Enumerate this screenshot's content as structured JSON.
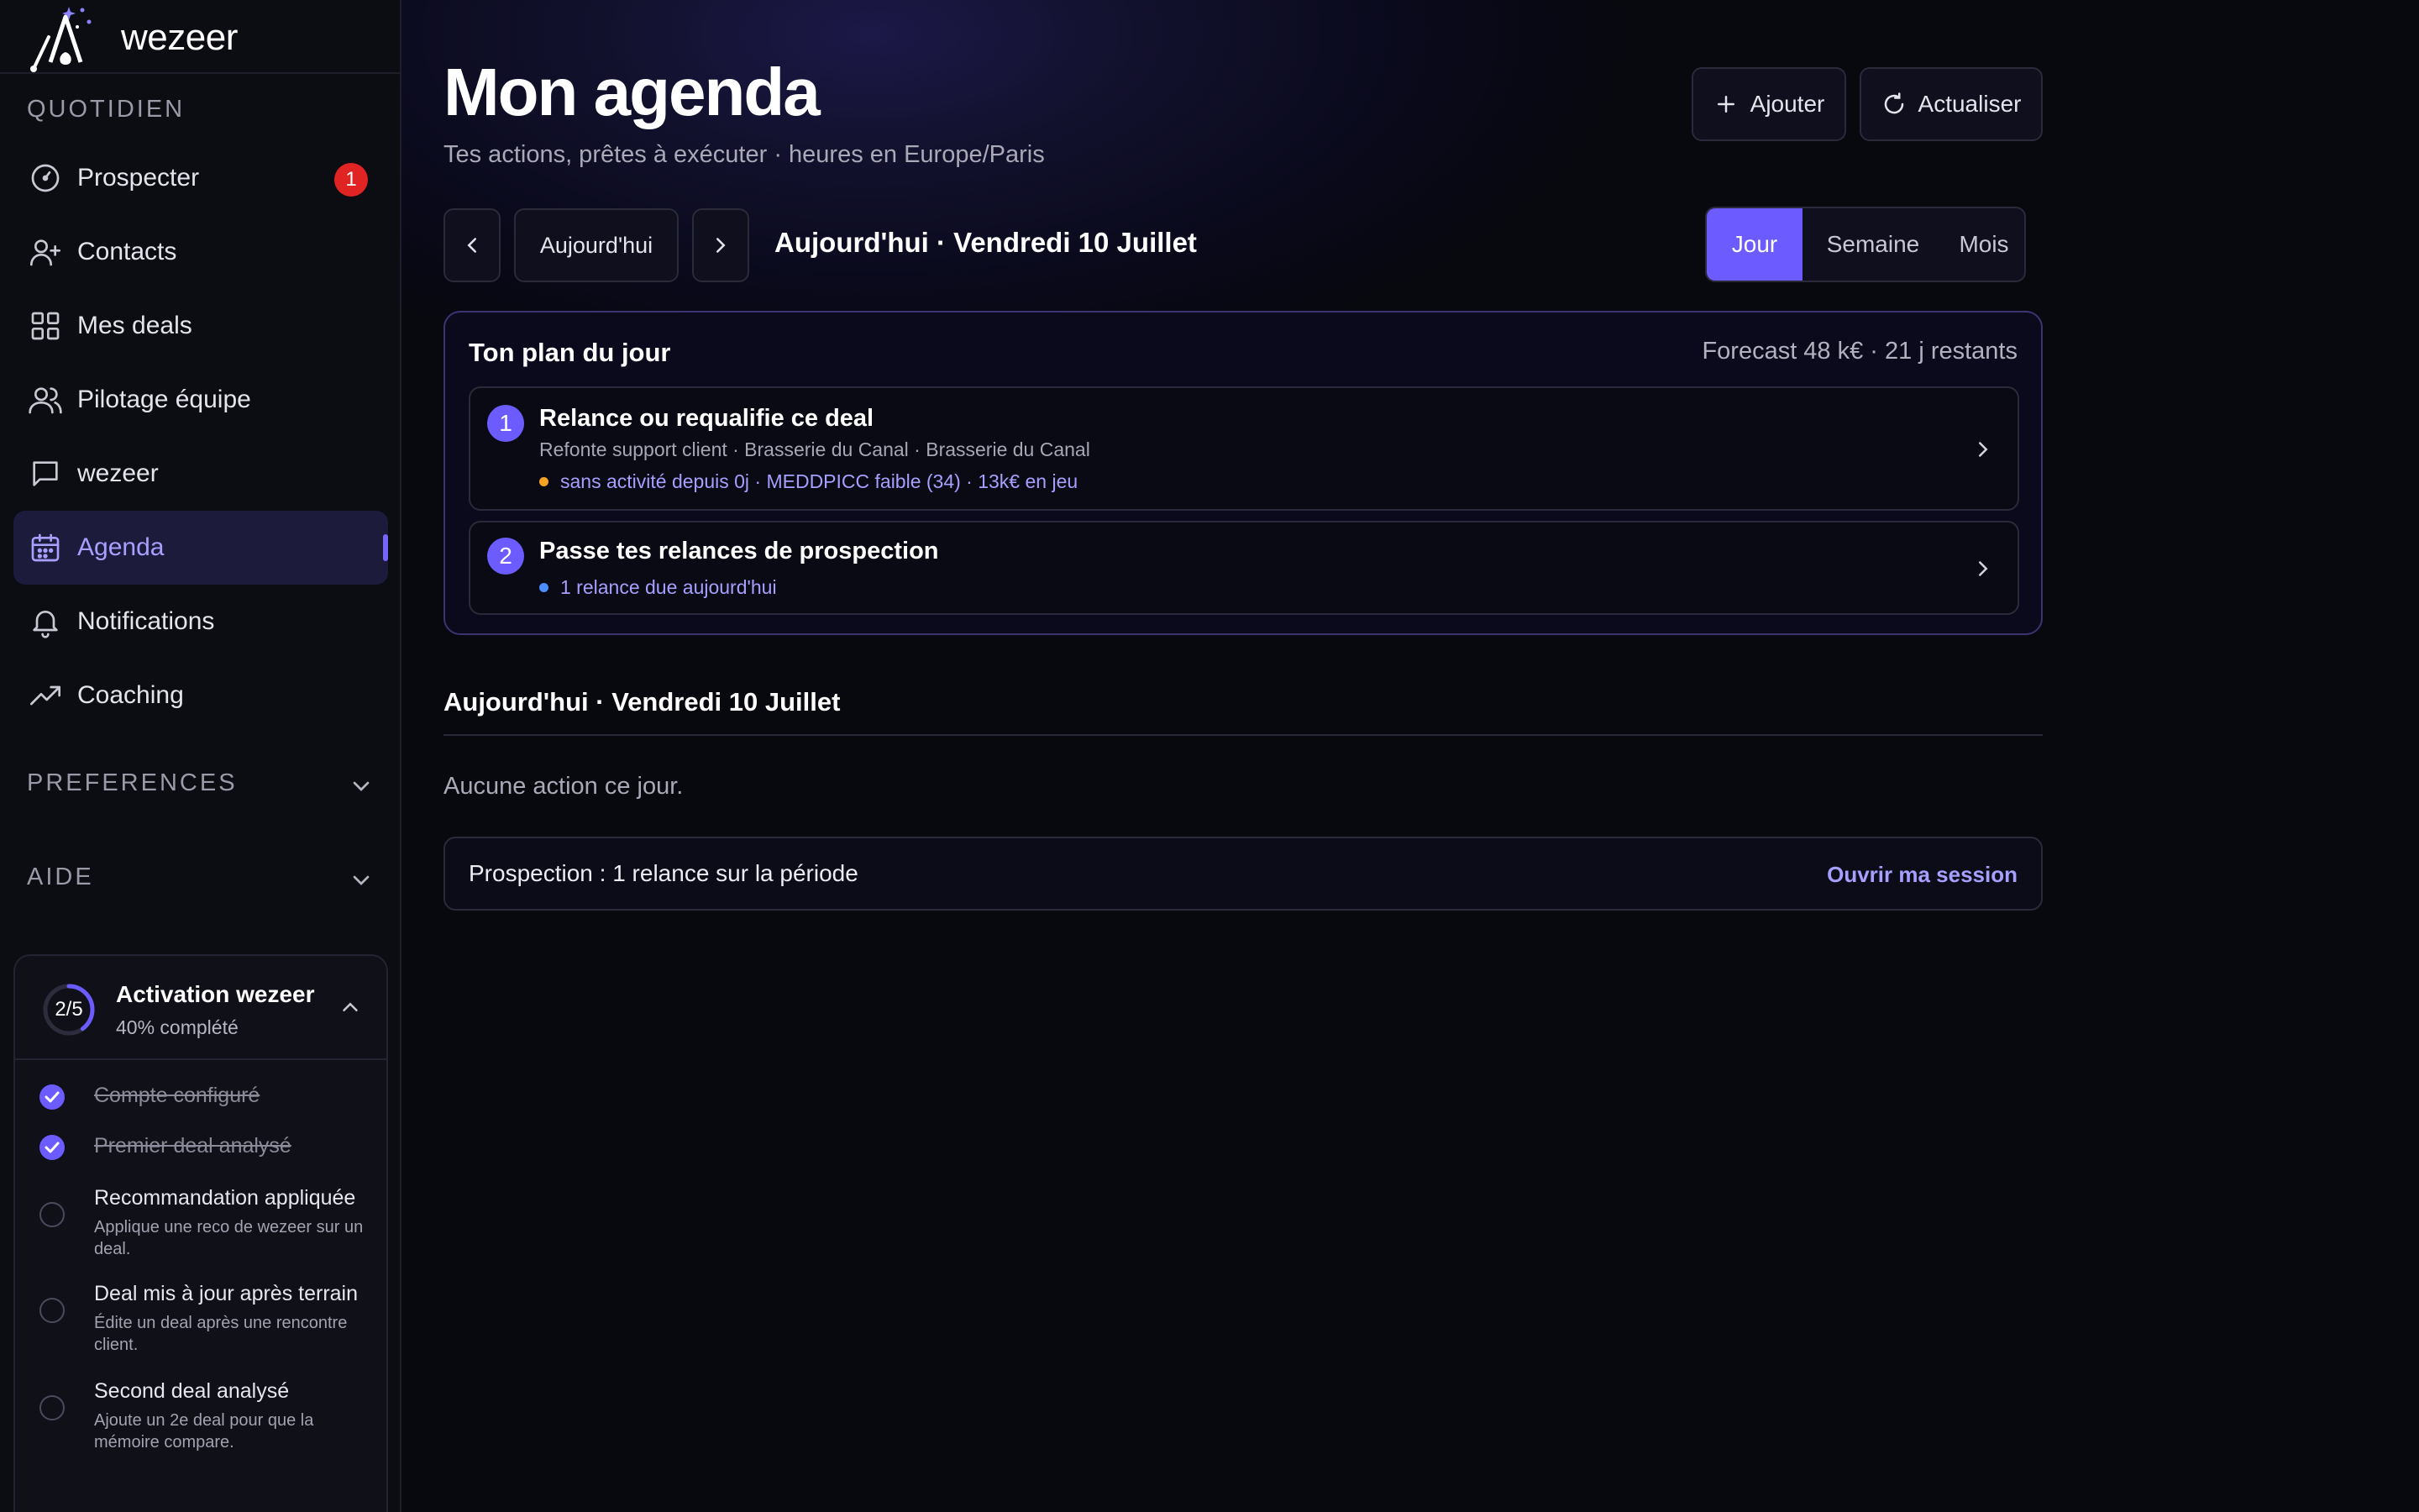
{
  "brand": {
    "name": "wezeer"
  },
  "sidebar": {
    "section_daily": "QUOTIDIEN",
    "items": [
      {
        "label": "Prospecter",
        "icon": "gauge-icon",
        "badge": "1"
      },
      {
        "label": "Contacts",
        "icon": "user-plus-icon"
      },
      {
        "label": "Mes deals",
        "icon": "grid-icon"
      },
      {
        "label": "Pilotage équipe",
        "icon": "users-icon"
      },
      {
        "label": "wezeer",
        "icon": "chat-icon"
      },
      {
        "label": "Agenda",
        "icon": "calendar-icon",
        "active": true
      },
      {
        "label": "Notifications",
        "icon": "bell-icon"
      },
      {
        "label": "Coaching",
        "icon": "trending-up-icon"
      }
    ],
    "section_preferences": "PREFERENCES",
    "section_help": "AIDE"
  },
  "activation": {
    "progress": "2/5",
    "progress_fraction": 0.4,
    "title": "Activation wezeer",
    "subtitle": "40% complété",
    "tasks": [
      {
        "title": "Compte configuré",
        "done": true
      },
      {
        "title": "Premier deal analysé",
        "done": true
      },
      {
        "title": "Recommandation appliquée",
        "desc": "Applique une reco de wezeer sur un deal.",
        "done": false
      },
      {
        "title": "Deal mis à jour après terrain",
        "desc": "Édite un deal après une rencontre client.",
        "done": false
      },
      {
        "title": "Second deal analysé",
        "desc": "Ajoute un 2e deal pour que la mémoire compare.",
        "done": false
      }
    ]
  },
  "header": {
    "title": "Mon agenda",
    "subtitle": "Tes actions, prêtes à exécuter · heures en Europe/Paris",
    "add_label": "Ajouter",
    "refresh_label": "Actualiser"
  },
  "toolbar": {
    "today_label": "Aujourd'hui",
    "date_title": "Aujourd'hui · Vendredi 10 Juillet",
    "views": [
      "Jour",
      "Semaine",
      "Mois"
    ],
    "active_view": "Jour"
  },
  "plan": {
    "title": "Ton plan du jour",
    "forecast": "Forecast 48 k€ · 21 j restants",
    "items": [
      {
        "number": "1",
        "title": "Relance ou requalifie ce deal",
        "subtitle": "Refonte support client · Brasserie du Canal · Brasserie du Canal",
        "meta": "sans activité depuis 0j · MEDDPICC faible (34) · 13k€ en jeu",
        "dot_color": "#f5a524"
      },
      {
        "number": "2",
        "title": "Passe tes relances de prospection",
        "meta": "1 relance due aujourd'hui",
        "dot_color": "#4c8dff"
      }
    ]
  },
  "day": {
    "heading": "Aujourd'hui · Vendredi 10 Juillet",
    "empty_text": "Aucune action ce jour."
  },
  "prospection": {
    "text": "Prospection : 1 relance sur la période",
    "link": "Ouvrir ma session"
  },
  "colors": {
    "accent": "#6c5cff",
    "badge": "#e02424",
    "link": "#a79fff"
  }
}
